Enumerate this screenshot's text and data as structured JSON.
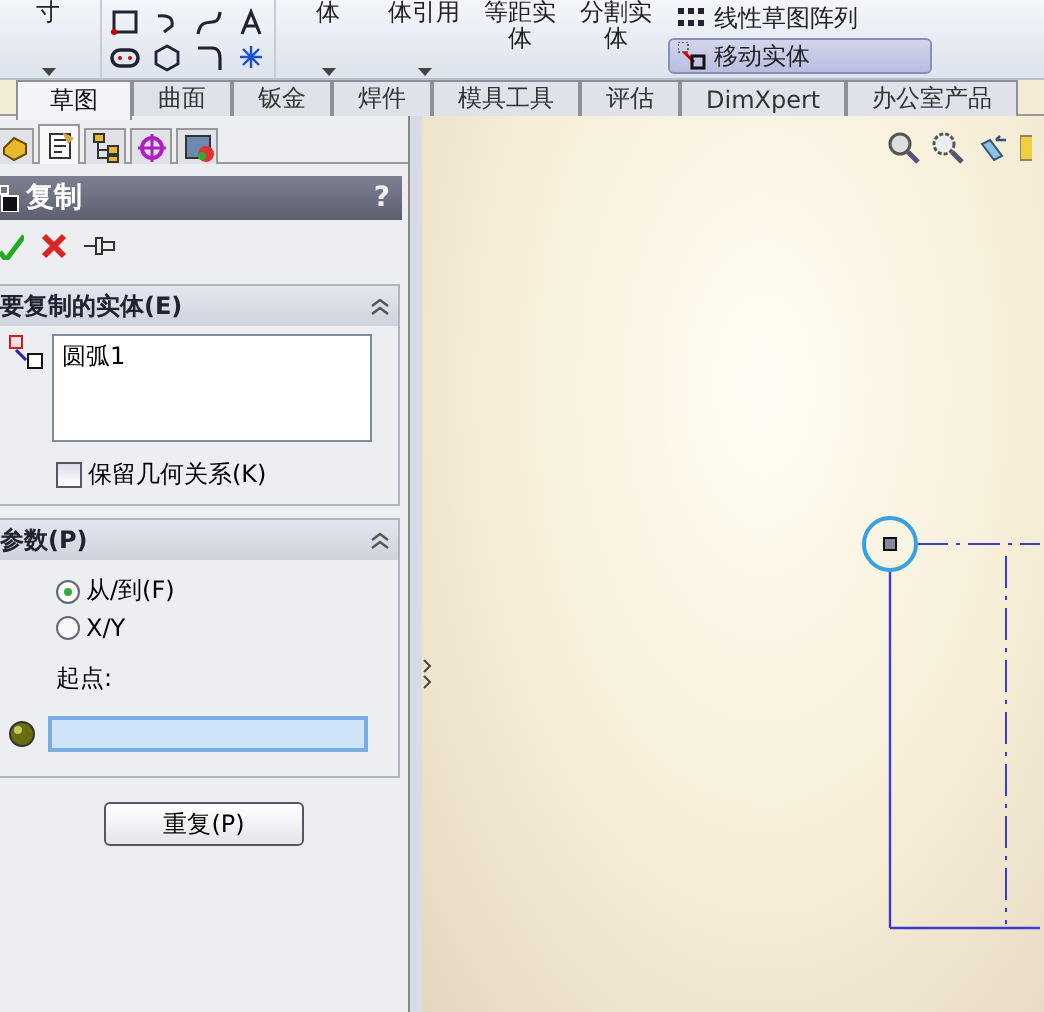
{
  "ribbon": {
    "buttons": [
      {
        "kind": "tall",
        "label": "寸",
        "caret": true
      },
      {
        "kind": "tools"
      },
      {
        "kind": "tall",
        "label": "体",
        "caret": true
      },
      {
        "kind": "tall",
        "label": "体引用",
        "caret": true
      },
      {
        "kind": "tall",
        "label": "等距实体",
        "caret": false
      },
      {
        "kind": "tall",
        "label": "分割实体",
        "caret": false
      },
      {
        "kind": "stack",
        "items": [
          {
            "label": "线性草图阵列",
            "selected": false
          },
          {
            "label": "移动实体",
            "selected": true
          }
        ]
      }
    ]
  },
  "tabs": [
    {
      "label": "草图",
      "selected": true
    },
    {
      "label": "曲面",
      "selected": false
    },
    {
      "label": "钣金",
      "selected": false
    },
    {
      "label": "焊件",
      "selected": false
    },
    {
      "label": "模具工具",
      "selected": false
    },
    {
      "label": "评估",
      "selected": false
    },
    {
      "label": "DimXpert",
      "selected": false
    },
    {
      "label": "办公室产品",
      "selected": false
    }
  ],
  "manager_tabs": [
    {
      "selected": false
    },
    {
      "selected": true
    },
    {
      "selected": false
    },
    {
      "selected": false
    },
    {
      "selected": false
    }
  ],
  "property_manager": {
    "title": "复制",
    "help": "?",
    "sections": [
      {
        "title": "要复制的实体(E)",
        "expanded": true,
        "kind": "entities",
        "list_items": [
          "圆弧1"
        ],
        "checkbox": {
          "label": "保留几何关系(K)",
          "checked": false
        }
      },
      {
        "title": "参数(P)",
        "expanded": true,
        "kind": "params",
        "radios": [
          {
            "label": "从/到(F)",
            "selected": true
          },
          {
            "label": "X/Y",
            "selected": false
          }
        ],
        "field_label": "起点:"
      }
    ],
    "button": "重复(P)"
  }
}
